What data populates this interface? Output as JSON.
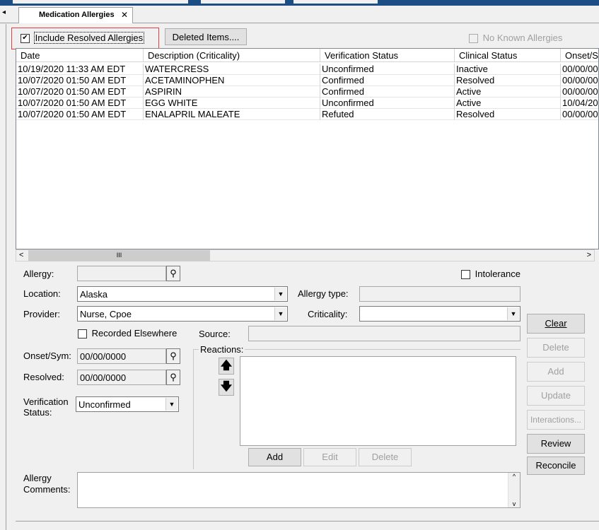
{
  "tab": {
    "label": "Medication Allergies",
    "close": "✕",
    "nav": "◂"
  },
  "toolbar": {
    "include_resolved_label": "Include Resolved Allergies",
    "include_resolved_checked": true,
    "deleted_items_label": "Deleted Items....",
    "no_known_label": "No Known Allergies"
  },
  "grid": {
    "columns": [
      "Date",
      "Description (Criticality)",
      "Verification Status",
      "Clinical Status",
      "Onset/S"
    ],
    "rows": [
      [
        "10/19/2020 11:33 AM EDT",
        "WATERCRESS",
        "Unconfirmed",
        "Inactive",
        "00/00/00"
      ],
      [
        "10/07/2020 01:50 AM EDT",
        "ACETAMINOPHEN",
        "Confirmed",
        "Resolved",
        "00/00/00"
      ],
      [
        "10/07/2020 01:50 AM EDT",
        "ASPIRIN",
        "Confirmed",
        "Active",
        "00/00/00"
      ],
      [
        "10/07/2020 01:50 AM EDT",
        "EGG WHITE",
        "Unconfirmed",
        "Active",
        "10/04/20"
      ],
      [
        "10/07/2020 01:50 AM EDT",
        "ENALAPRIL MALEATE",
        "Refuted",
        "Resolved",
        "00/00/00"
      ]
    ]
  },
  "scroll": {
    "left": "<",
    "right": ">",
    "thumb": "III"
  },
  "form": {
    "allergy_label": "Allergy:",
    "allergy_value": "",
    "intolerance_label": "Intolerance",
    "location_label": "Location:",
    "location_value": "Alaska",
    "allergy_type_label": "Allergy type:",
    "provider_label": "Provider:",
    "provider_value": "Nurse, Cpoe",
    "criticality_label": "Criticality:",
    "recorded_elsewhere_label": "Recorded Elsewhere",
    "source_label": "Source:",
    "onset_label": "Onset/Sym:",
    "onset_value": "00/00/0000",
    "resolved_label": "Resolved:",
    "resolved_value": "00/00/0000",
    "verification_label_1": "Verification",
    "verification_label_2": "Status:",
    "verification_value": "Unconfirmed",
    "reactions_label": "Reactions:",
    "comments_label_1": "Allergy",
    "comments_label_2": "Comments:"
  },
  "reaction_buttons": {
    "add": "Add",
    "edit": "Edit",
    "delete": "Delete"
  },
  "side_buttons": {
    "clear": "Clear",
    "delete": "Delete",
    "add": "Add",
    "update": "Update",
    "interactions": "Interactions...",
    "review": "Review",
    "reconcile": "Reconcile"
  },
  "colors": {
    "header_bar": "#1c4e86",
    "highlight_box": "#e04040"
  }
}
